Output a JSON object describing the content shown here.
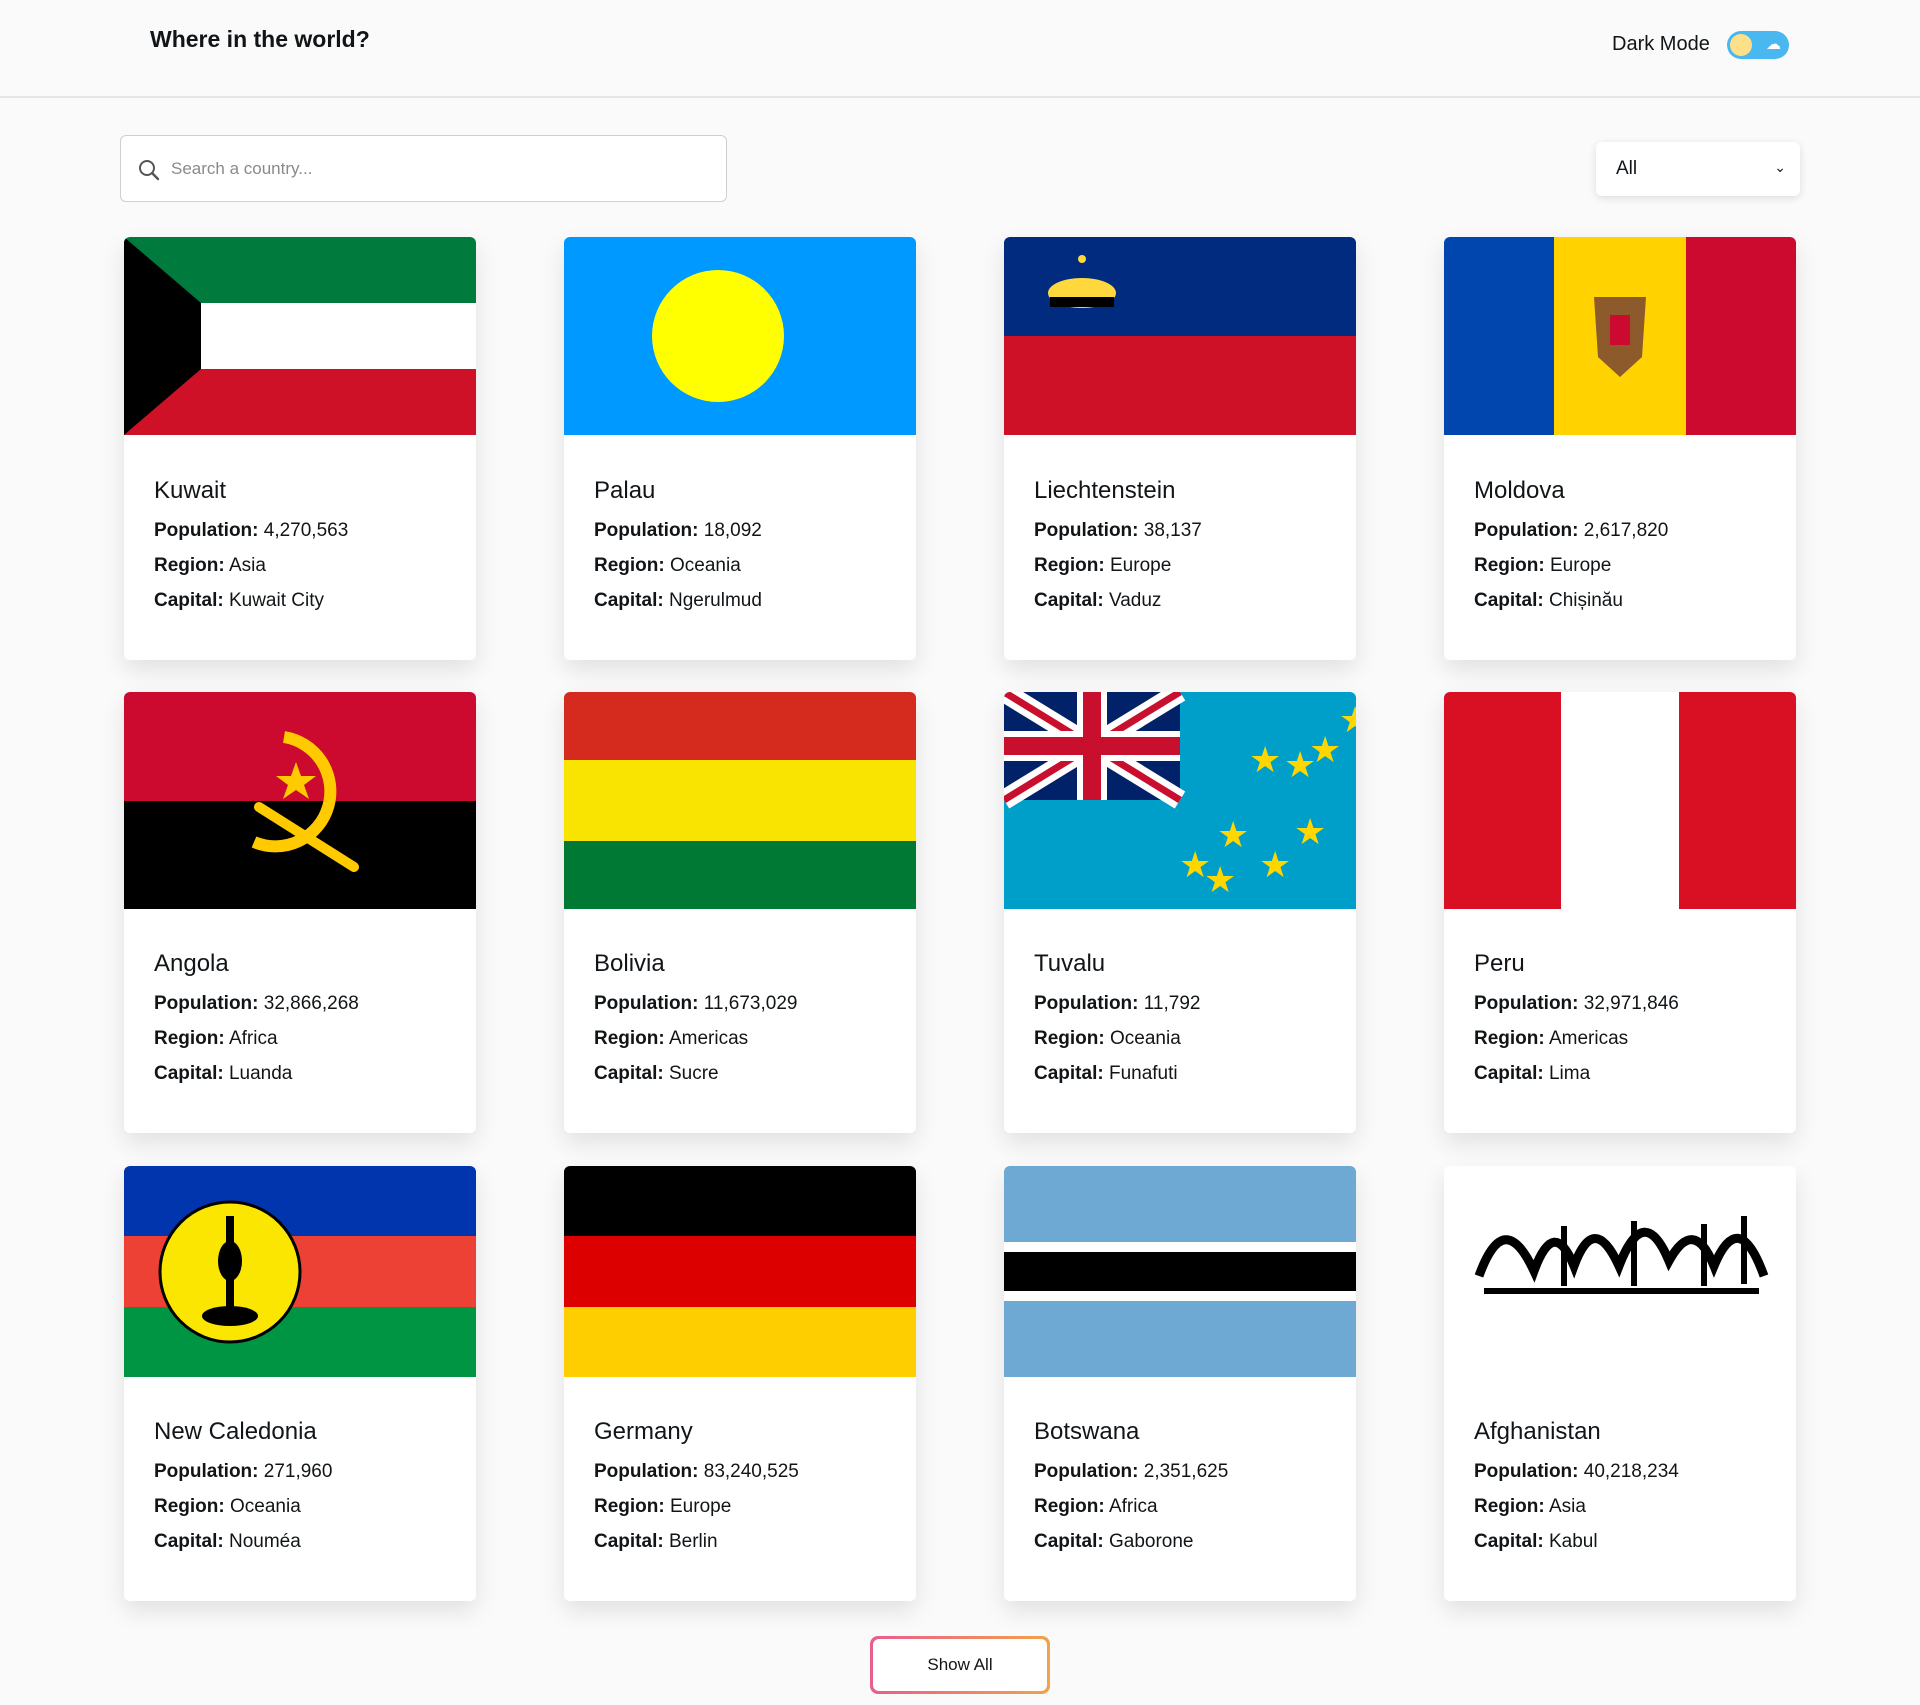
{
  "header": {
    "title": "Where in the world?",
    "mode_label": "Dark Mode"
  },
  "search": {
    "placeholder": "Search a country..."
  },
  "filter": {
    "selected": "All"
  },
  "labels": {
    "population": "Population:",
    "region": "Region:",
    "capital": "Capital:"
  },
  "countries": [
    {
      "name": "Kuwait",
      "population": "4,270,563",
      "region": "Asia",
      "capital": "Kuwait City"
    },
    {
      "name": "Palau",
      "population": "18,092",
      "region": "Oceania",
      "capital": "Ngerulmud"
    },
    {
      "name": "Liechtenstein",
      "population": "38,137",
      "region": "Europe",
      "capital": "Vaduz"
    },
    {
      "name": "Moldova",
      "population": "2,617,820",
      "region": "Europe",
      "capital": "Chișinău"
    },
    {
      "name": "Angola",
      "population": "32,866,268",
      "region": "Africa",
      "capital": "Luanda"
    },
    {
      "name": "Bolivia",
      "population": "11,673,029",
      "region": "Americas",
      "capital": "Sucre"
    },
    {
      "name": "Tuvalu",
      "population": "11,792",
      "region": "Oceania",
      "capital": "Funafuti"
    },
    {
      "name": "Peru",
      "population": "32,971,846",
      "region": "Americas",
      "capital": "Lima"
    },
    {
      "name": "New Caledonia",
      "population": "271,960",
      "region": "Oceania",
      "capital": "Nouméa"
    },
    {
      "name": "Germany",
      "population": "83,240,525",
      "region": "Europe",
      "capital": "Berlin"
    },
    {
      "name": "Botswana",
      "population": "2,351,625",
      "region": "Africa",
      "capital": "Gaborone"
    },
    {
      "name": "Afghanistan",
      "population": "40,218,234",
      "region": "Asia",
      "capital": "Kabul"
    }
  ],
  "flag_icons": [
    "kuwait-flag-icon",
    "palau-flag-icon",
    "liechtenstein-flag-icon",
    "moldova-flag-icon",
    "angola-flag-icon",
    "bolivia-flag-icon",
    "tuvalu-flag-icon",
    "peru-flag-icon",
    "new-caledonia-flag-icon",
    "germany-flag-icon",
    "botswana-flag-icon",
    "afghanistan-flag-icon"
  ],
  "actions": {
    "show_all": "Show All"
  }
}
